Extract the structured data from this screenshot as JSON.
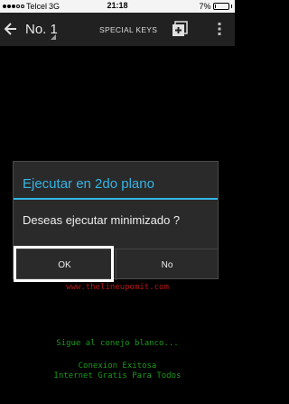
{
  "status_bar": {
    "carrier": "Telcel",
    "network": "3G",
    "time": "21:18",
    "battery_text": "7%",
    "battery_level": 0.07
  },
  "action_bar": {
    "title": "No. 1",
    "special_keys_label": "SPECIAL KEYS",
    "icons": [
      "back-arrow-icon",
      "plus-box-icon",
      "overflow-menu-icon"
    ]
  },
  "terminal": {
    "url_line": "www.thelineupomit.com",
    "line_1": "Sigue al conejo blanco...",
    "line_2": "Conexion Exitosa",
    "line_3": "Internet Gratis Para Todos",
    "text_color": "#1a9a1a",
    "url_color": "#b01818"
  },
  "dialog": {
    "title": "Ejecutar en 2do plano",
    "message": "Deseas ejecutar minimizado ?",
    "ok_label": "OK",
    "no_label": "No",
    "accent_color": "#33b5e5"
  }
}
